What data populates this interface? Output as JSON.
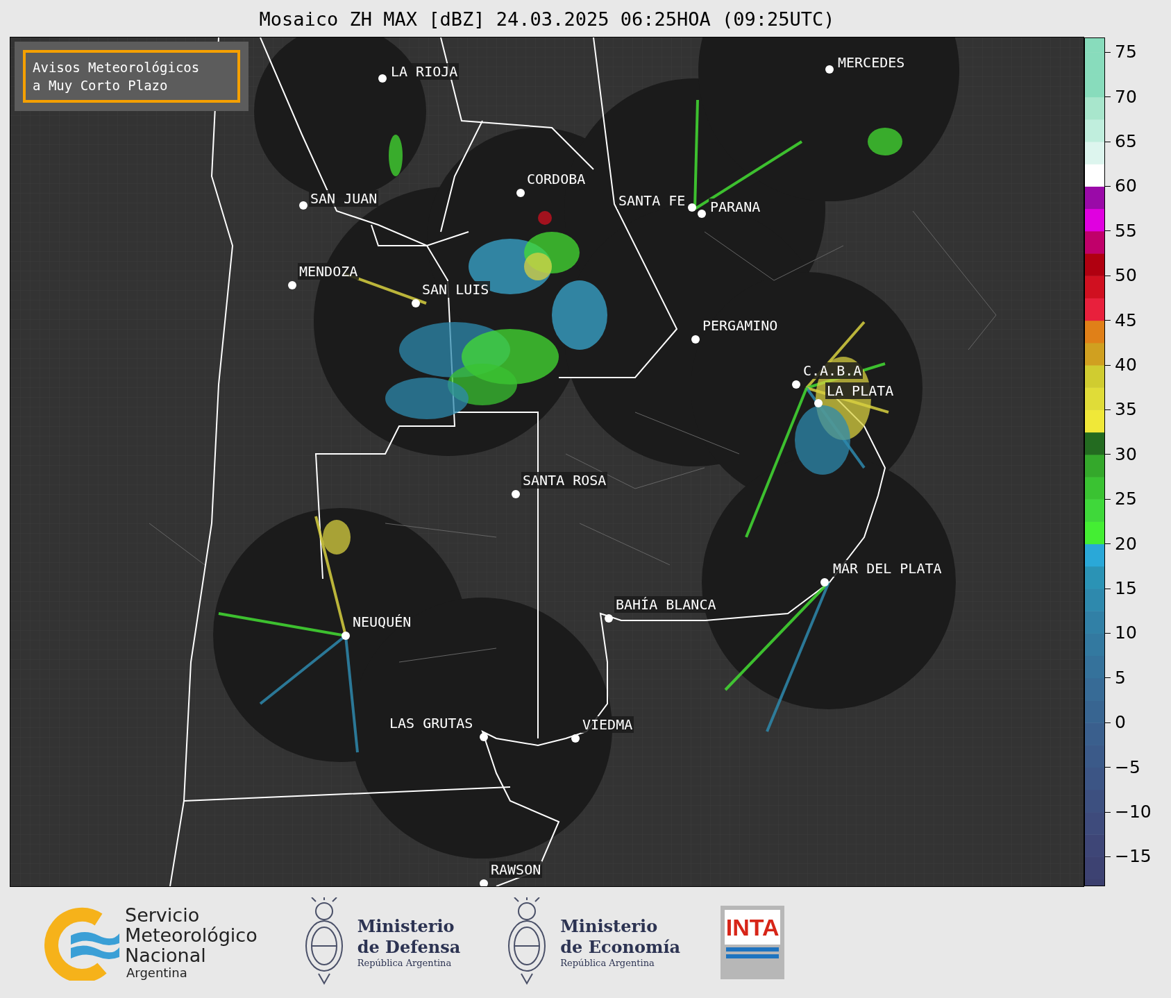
{
  "title": "Mosaico ZH MAX [dBZ] 24.03.2025 06:25HOA (09:25UTC)",
  "notice": {
    "lines": [
      "Avisos Meteorológicos",
      "a Muy Corto Plazo"
    ]
  },
  "cities": [
    {
      "name": "LA RIOJA"
    },
    {
      "name": "SAN JUAN"
    },
    {
      "name": "CORDOBA"
    },
    {
      "name": "SANTA FE"
    },
    {
      "name": "PARANA"
    },
    {
      "name": "MENDOZA"
    },
    {
      "name": "SAN LUIS"
    },
    {
      "name": "MERCEDES"
    },
    {
      "name": "PERGAMINO"
    },
    {
      "name": "C.A.B.A"
    },
    {
      "name": "LA PLATA"
    },
    {
      "name": "SANTA ROSA"
    },
    {
      "name": "MAR DEL PLATA"
    },
    {
      "name": "BAHÍA BLANCA"
    },
    {
      "name": "NEUQUÉN"
    },
    {
      "name": "LAS GRUTAS"
    },
    {
      "name": "VIEDMA"
    },
    {
      "name": "RAWSON"
    }
  ],
  "colorbar": {
    "ticks": [
      "75",
      "70",
      "65",
      "60",
      "55",
      "50",
      "45",
      "40",
      "35",
      "30",
      "25",
      "20",
      "15",
      "10",
      "5",
      "0",
      "−5",
      "−10",
      "−15"
    ]
  },
  "footer": {
    "smn": {
      "lines": [
        "Servicio",
        "Meteorológico",
        "Nacional"
      ],
      "country": "Argentina"
    },
    "ministries": [
      {
        "name": "Ministerio",
        "sub": "de Defensa",
        "country": "República Argentina"
      },
      {
        "name": "Ministerio",
        "sub": "de Economía",
        "country": "República Argentina"
      }
    ],
    "inta": "INTA"
  }
}
